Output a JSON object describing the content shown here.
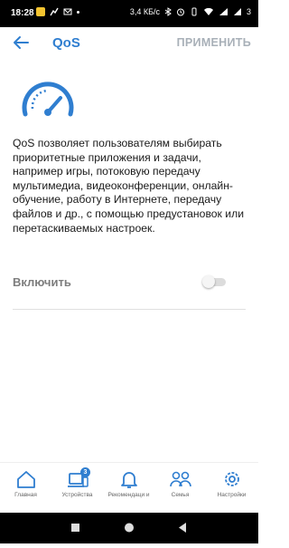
{
  "status_bar": {
    "time": "18:28",
    "network_speed": "3,4 КБ/с",
    "battery": "3"
  },
  "app_bar": {
    "title": "QoS",
    "apply_label": "ПРИМЕНИТЬ"
  },
  "description": "QoS позволяет пользователям выбирать приоритетные приложения и задачи, например игры, потоковую передачу мультимедиа, видеоконференции, онлайн-обучение, работу в Интернете, передачу файлов и др., с помощью предустановок или перетаскиваемых настроек.",
  "enable": {
    "label": "Включить",
    "state": "off"
  },
  "bottom_nav": {
    "items": [
      {
        "label": "Главная",
        "icon": "home-icon"
      },
      {
        "label": "Устройства",
        "icon": "devices-icon",
        "badge": "3"
      },
      {
        "label": "Рекомендаци и",
        "icon": "bell-icon"
      },
      {
        "label": "Семья",
        "icon": "family-icon"
      },
      {
        "label": "Настройки",
        "icon": "gear-icon"
      }
    ]
  },
  "colors": {
    "accent": "#2f7ed0",
    "apply_disabled": "#a8b0b8"
  }
}
